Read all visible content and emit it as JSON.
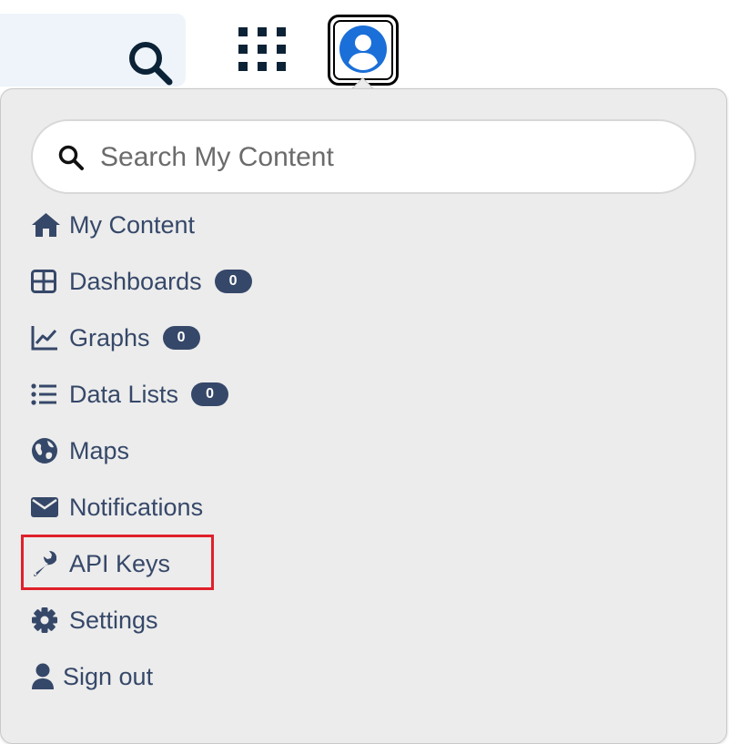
{
  "header": {
    "search_icon": "search-icon",
    "apps_icon": "grid-icon",
    "avatar_icon": "user-circle-icon"
  },
  "menu": {
    "search": {
      "placeholder": "Search My Content",
      "value": ""
    },
    "items": [
      {
        "label": "My Content",
        "icon": "home-icon"
      },
      {
        "label": "Dashboards",
        "icon": "table-grid-icon",
        "badge": "0"
      },
      {
        "label": "Graphs",
        "icon": "line-chart-icon",
        "badge": "0"
      },
      {
        "label": "Data Lists",
        "icon": "list-icon",
        "badge": "0"
      },
      {
        "label": "Maps",
        "icon": "globe-icon"
      },
      {
        "label": "Notifications",
        "icon": "envelope-icon"
      },
      {
        "label": "API Keys",
        "icon": "wrench-icon",
        "highlighted": true
      },
      {
        "label": "Settings",
        "icon": "gear-icon"
      },
      {
        "label": "Sign out",
        "icon": "user-icon"
      }
    ]
  },
  "colors": {
    "menu_text": "#364869",
    "badge_bg": "#364869",
    "highlight": "#e0202a",
    "avatar_blue": "#1a6fd8",
    "dropdown_bg": "#ececec"
  }
}
